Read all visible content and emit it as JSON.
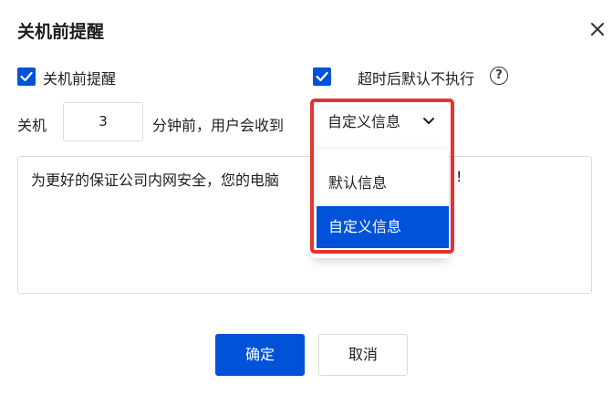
{
  "dialog": {
    "title": "关机前提醒",
    "close_icon": "close-icon"
  },
  "options": {
    "remind_before_shutdown": {
      "label": "关机前提醒",
      "checked": true
    },
    "timeout_default_not_execute": {
      "label": "超时后默认不执行",
      "checked": true,
      "help_icon": "question-circle-icon",
      "help_glyph": "?"
    }
  },
  "shutdown_row": {
    "prefix": "关机",
    "minutes_value": "3",
    "suffix": "分钟前，用户会收到",
    "message_type_selected": "自定义信息",
    "chevron_icon": "chevron-down-icon"
  },
  "message": {
    "text_visible": "为更好的保证公司内网安全，您的电脑",
    "text_tail": "!"
  },
  "dropdown": {
    "options": [
      "默认信息",
      "自定义信息"
    ],
    "selected_index": 1
  },
  "footer": {
    "confirm_label": "确定",
    "cancel_label": "取消"
  },
  "colors": {
    "primary": "#0052d9",
    "highlight_border": "#e3342f",
    "border": "#dcdcdc"
  }
}
